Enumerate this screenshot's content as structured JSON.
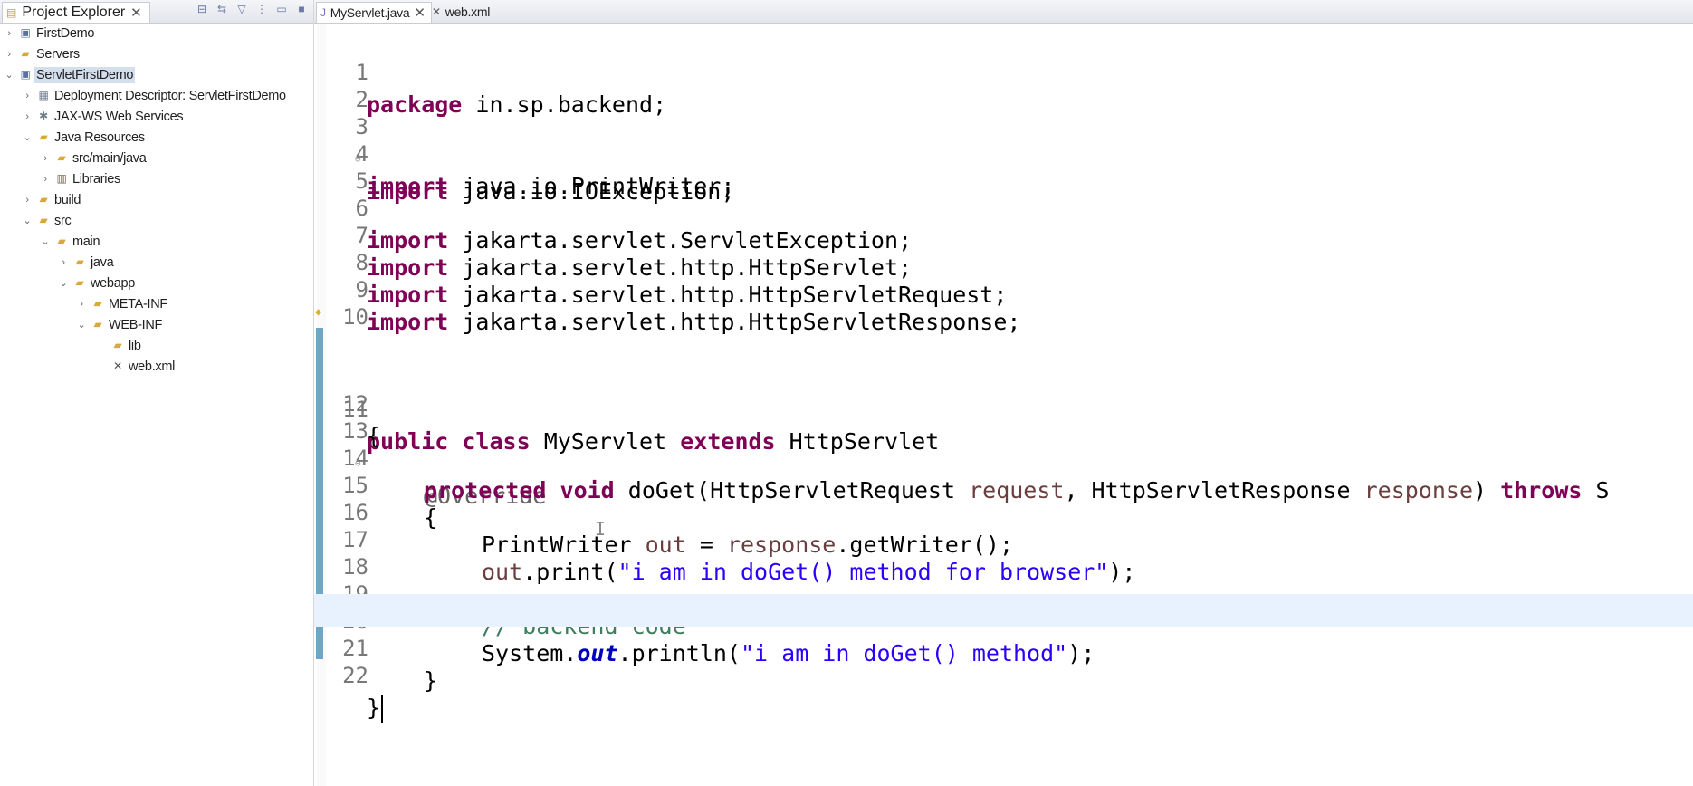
{
  "explorer": {
    "tab_label": "Project Explorer",
    "tools": [
      "collapse-all-icon",
      "link-editor-icon",
      "filter-icon",
      "view-menu-icon",
      "minimize-icon",
      "maximize-icon"
    ],
    "items": [
      {
        "label": "FirstDemo"
      },
      {
        "label": "Servers"
      },
      {
        "label": "ServletFirstDemo"
      },
      {
        "label": "Deployment Descriptor: ServletFirstDemo"
      },
      {
        "label": "JAX-WS Web Services"
      },
      {
        "label": "Java Resources"
      },
      {
        "label": "src/main/java"
      },
      {
        "label": "Libraries"
      },
      {
        "label": "build"
      },
      {
        "label": "src"
      },
      {
        "label": "main"
      },
      {
        "label": "java"
      },
      {
        "label": "webapp"
      },
      {
        "label": "META-INF"
      },
      {
        "label": "WEB-INF"
      },
      {
        "label": "lib"
      },
      {
        "label": "web.xml"
      }
    ]
  },
  "editor": {
    "tabs": [
      {
        "label": "MyServlet.java"
      },
      {
        "label": "web.xml"
      }
    ],
    "line_numbers": [
      "1",
      "2",
      "3",
      "4",
      "5",
      "6",
      "7",
      "8",
      "9",
      "10",
      "11",
      "12",
      "13",
      "14",
      "15",
      "16",
      "17",
      "18",
      "19",
      "20",
      "21",
      "22"
    ],
    "tokens": {
      "package": "package",
      "package_name": " in.sp.backend;",
      "import": "import",
      "imp3": " java.io.IOException;",
      "imp4": " java.io.PrintWriter;",
      "imp6": " jakarta.servlet.ServletException;",
      "imp7": " jakarta.servlet.http.HttpServlet;",
      "imp8": " jakarta.servlet.http.HttpServletRequest;",
      "imp9": " jakarta.servlet.http.HttpServletResponse;",
      "public": "public",
      "class": "class",
      "class_name": "MyServlet",
      "extends": "extends",
      "super_class": "HttpServlet",
      "open_brace": "{",
      "close_brace": "}",
      "override": "@Override",
      "protected": "protected",
      "void": "void",
      "method_sig1": " doGet(HttpServletRequest ",
      "request": "request",
      "method_sig2": ", HttpServletResponse ",
      "response": "response",
      "method_sig3": ") ",
      "throws": "throws",
      "throws_rest": " S",
      "pw_type": "PrintWriter ",
      "out": "out",
      "assign": " = ",
      "get_writer": ".getWriter();",
      "print_call": ".print(",
      "str1": "\"i am in doGet() method for browser\"",
      "stmt_end": ");",
      "comment": "// backend code",
      "system": "System.",
      "println_call": ".println(",
      "str2": "\"i am in doGet() method\""
    }
  }
}
